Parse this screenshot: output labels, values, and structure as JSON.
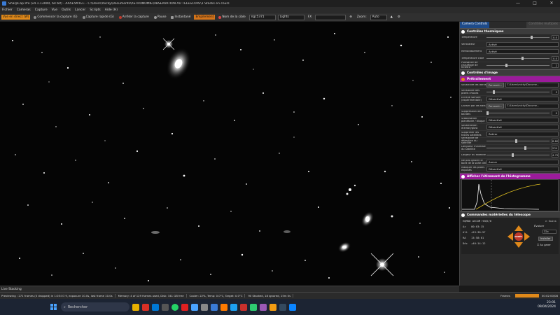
{
  "window": {
    "title": "SharpCap Pro (v4.1.13000, 64 bit) - AA5E5MTEC - C:\\Users\\micky\\Documents\\ASTRONOMIE\\OBSERVATION AU TELESCOPE\\1 Stacks en cours",
    "minimize": "—",
    "maximize": "□",
    "close": "✕"
  },
  "menu": [
    "Fichier",
    "Cameras",
    "Capture",
    "Vue",
    "Outils",
    "Lancer",
    "Scripts",
    "Aide (H)"
  ],
  "toolbar": {
    "live": "Vue en direct (W)",
    "start_capture": "Commencer la capture (G)",
    "quick_capture": "Capture rapide (G)",
    "stop_capture": "Arrêter la capture",
    "pause": "Pause",
    "snapshot": "Instantané",
    "stack": "Empilement",
    "target_label": "Nom de la cible",
    "target_value": "ngc5371",
    "frame_type": "Lights",
    "fx": "FX",
    "zoom_label": "Zoom:",
    "zoom_value": "Auto"
  },
  "panel": {
    "tab_active": "Camera Controls",
    "tab_inactive": "Contrôles multiples",
    "thermal": {
      "title": "Contrôles thermiques",
      "temperature_label": "Température",
      "temperature_value": "0.0",
      "fan_label": "Ventilateur",
      "fan_value": "Activé",
      "cooling_label": "Refroidissement",
      "cooling_value": "Activé",
      "target_temp_label": "Température cible",
      "target_temp_value": "0.0",
      "heating_label": "Puissance de chauffage de fenêtre",
      "heating_value": "2"
    },
    "image_controls": {
      "title": "Contrôles d'image"
    },
    "preprocessing": {
      "title": "Prétraitement",
      "dark_label": "Soustraire les darks",
      "browse": "Parcourir...",
      "dark_path": "C:\\Users\\micky\\Docume...",
      "hot_label": "Sensibilité des pixels chauds",
      "hot_value": "5",
      "cold_label": "Échelle sombre (expérimentale)",
      "cold_value": "Désactivé",
      "flat_label": "Diviser par les flats",
      "flat_path": "C:\\Users\\micky\\Docume...",
      "banding_label": "Suppression des bandes",
      "banding_value": "0",
      "stabilize_label": "Stabilisation planétaire / disque",
      "stabilize_value": "Désactivé",
      "amp_label": "Soustraction d'ambryglow",
      "amp_value": "Désactivé",
      "satellite_label": "Supprimer les traces satellites",
      "satellite_value": "Retirer",
      "threshold_label": "Sensibilité de détection du satellite",
      "threshold_value": "8.80",
      "min_length_label": "Longueur minimale du satellite",
      "min_length_value": "234",
      "width_label": "Largeur du satellite",
      "width_value": "4.72",
      "edge_label": "Ne pas ignorer le bord de la suite ciel",
      "edge_value": "Aucun",
      "mask_label": "Masquer les pixels exposés",
      "mask_value": "Désactivé"
    },
    "histogram": {
      "title": "Afficher l'étirement de l'histogramme"
    },
    "scope": {
      "title": "Commandes matérielles du télescope",
      "device": "EQMOD ASCOM HEQ5/6",
      "tracking": "Suivi",
      "az_label": "Az",
      "az_value": "00:03:15",
      "alt_label": "Alt",
      "alt_value": "+53:30:57",
      "ra_label": "RA",
      "ra_value": "13:58:01",
      "dec_label": "Déc",
      "dec_value": "+40:14:12",
      "rate_label": "Évaluer",
      "rate_value": "32x",
      "install": "Installer",
      "park": "Au garer",
      "stop": "ARRÊT"
    }
  },
  "live_stacking": "Live Stacking",
  "status": {
    "preview": "Previewing : 271 frames (0 dropped) in 1:03:07.9, exposure 10.0s, last frame 10.0s",
    "memory": "Memory: 4 of 129 frames used, Disk: 341 GB free",
    "cooler": "Cooler: 22%, Temp: 0.0°C, Target: 0.0°C",
    "stacked": "90 Stacked, 18 ignored, 15m 0s",
    "frames_label": "Frames",
    "time": "00:02:00/08"
  },
  "taskbar": {
    "search": "Rechercher",
    "time": "23:01",
    "date": "09/04/2024"
  },
  "colors": {
    "accent_orange": "#e0891a",
    "section_purple": "#9b1b9b",
    "panel_tab_blue": "#1e4b8a"
  }
}
